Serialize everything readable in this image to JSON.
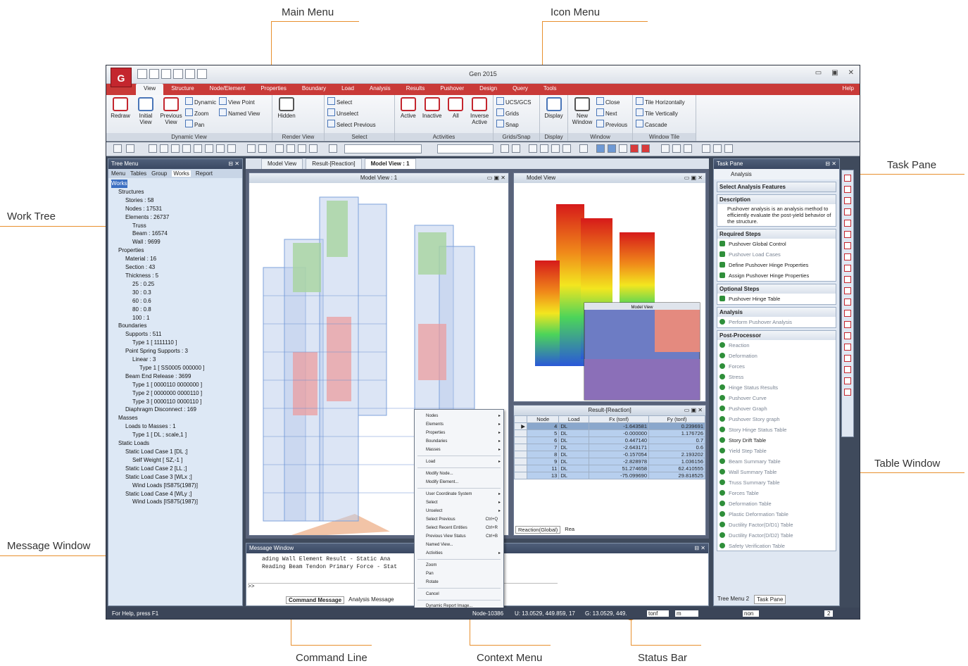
{
  "callouts": {
    "main_menu": "Main Menu",
    "icon_menu": "Icon Menu",
    "task_pane": "Task Pane",
    "work_tree": "Work Tree",
    "table_window": "Table Window",
    "message_window": "Message Window",
    "command_line": "Command Line",
    "context_menu": "Context Menu",
    "status_bar": "Status Bar"
  },
  "app": {
    "logo": "G",
    "title": "Gen 2015",
    "help": "Help",
    "menu_tabs": [
      "View",
      "Structure",
      "Node/Element",
      "Properties",
      "Boundary",
      "Load",
      "Analysis",
      "Results",
      "Pushover",
      "Design",
      "Query",
      "Tools"
    ]
  },
  "ribbon": {
    "dynamic_view": {
      "label": "Dynamic View",
      "redraw": "Redraw",
      "initial": "Initial View",
      "previous": "Previous View",
      "dynamic": "Dynamic",
      "zoom": "Zoom",
      "pan": "Pan",
      "view_point": "View Point",
      "named_view": "Named View"
    },
    "render_view": {
      "label": "Render View",
      "hidden": "Hidden"
    },
    "select": {
      "label": "Select",
      "select": "Select",
      "unselect": "Unselect",
      "select_previous": "Select Previous"
    },
    "activities": {
      "label": "Activities",
      "active": "Active",
      "inactive": "Inactive",
      "all": "All",
      "inverse": "Inverse Active"
    },
    "grids_snap": {
      "label": "Grids/Snap",
      "ucs": "UCS/GCS",
      "grids": "Grids",
      "snap": "Snap"
    },
    "display": {
      "label": "Display",
      "display": "Display"
    },
    "window": {
      "label": "Window",
      "new_window": "New Window",
      "close": "Close",
      "next": "Next",
      "previous": "Previous"
    },
    "window_tile": {
      "label": "Window Tile",
      "horizontal": "Tile Horizontally",
      "vertical": "Tile Vertically",
      "cascade": "Cascade"
    }
  },
  "tree": {
    "title": "Tree Menu",
    "tabs": [
      "Menu",
      "Tables",
      "Group",
      "Works",
      "Report"
    ],
    "items": [
      "Works",
      "Structures",
      "Stories : 58",
      "Nodes : 17531",
      "Elements : 26737",
      "Truss",
      "Beam : 16574",
      "Wall : 9699",
      "Properties",
      "Material : 16",
      "Section : 43",
      "Thickness : 5",
      "25 : 0.25",
      "30 : 0.3",
      "60 : 0.6",
      "80 : 0.8",
      "100 : 1",
      "Boundaries",
      "Supports : 511",
      "Type 1 [ 1111110 ]",
      "Point Spring Supports : 3",
      "Linear : 3",
      "Type 1 [ SS0005 000000 ]",
      "Beam End Release : 3699",
      "Type 1 [ 0000110 0000000 ]",
      "Type 2 [ 0000000 0000110 ]",
      "Type 3 [ 0000110 0000110 ]",
      "Diaphragm Disconnect : 169",
      "Masses",
      "Loads to Masses : 1",
      "Type 1 [ DL ; scale,1 ]",
      "Static Loads",
      "Static Load Case 1 [DL ;]",
      "Self Weight [ SZ,-1 ]",
      "Static Load Case 2 [LL ;]",
      "Static Load Case 3 [WLx ;]",
      "Wind Loads [IS875(1987)]",
      "Static Load Case 4 [WLy ;]",
      "Wind Loads [IS875(1987)]"
    ]
  },
  "doc_tabs": [
    "Model View",
    "Result-[Reaction]",
    "Model View : 1"
  ],
  "model_view_1": {
    "title": "Model View : 1"
  },
  "model_view_2": {
    "title": "Model View",
    "inset": "Model View"
  },
  "result_table": {
    "title": "Result-[Reaction]",
    "headers": [
      "Node",
      "Load",
      "Fx (tonf)",
      "Fy (tonf)"
    ],
    "rows": [
      [
        "4",
        "DL",
        "-1.643581",
        "0.239691"
      ],
      [
        "5",
        "DL",
        "-0.000000",
        "1.176726"
      ],
      [
        "6",
        "DL",
        "0.447140",
        "0.7",
        "-"
      ],
      [
        "7",
        "DL",
        "-2.643171",
        "0.6",
        "-"
      ],
      [
        "8",
        "DL",
        "-0.157054",
        "2.193202"
      ],
      [
        "9",
        "DL",
        "-2.828978",
        "1.036156"
      ],
      [
        "11",
        "DL",
        "51.274658",
        "62.410555"
      ],
      [
        "13",
        "DL",
        "-75.099690",
        "29.818525"
      ]
    ],
    "sheet_tab": "Reaction(Global)",
    "sheet_tab2": "Rea"
  },
  "task_pane": {
    "title": "Task Pane",
    "mode": "Analysis",
    "features": "Select Analysis Features",
    "description_title": "Description",
    "description": "Pushover analysis is an analysis method to efficiently evaluate the post-yield behavior of the structure.",
    "required_title": "Required Steps",
    "required": [
      "Pushover Global Control",
      "Pushover Load Cases",
      "Define Pushover Hinge Properties",
      "Assign Pushover Hinge Properties"
    ],
    "optional_title": "Optional Steps",
    "optional": [
      "Pushover Hinge Table"
    ],
    "analysis_title": "Analysis",
    "analysis": [
      "Perform Pushover Analysis"
    ],
    "post_title": "Post-Processor",
    "post": [
      "Reaction",
      "Deformation",
      "Forces",
      "Stress",
      "Hinge Status Results",
      "Pushover Curve",
      "Pushover Graph",
      "Pushover Story graph",
      "Story Hinge Status Table",
      "Story Drift Table",
      "Yield Step Table",
      "Beam Summary Table",
      "Wall Summary Table",
      "Truss Summary Table",
      "Forces Table",
      "Deformation Table",
      "Plastic Deformation Table",
      "Ductility Factor(D/D1) Table",
      "Ductility Factor(D/D2) Table",
      "Safety Verification Table"
    ],
    "bottom_tabs": [
      "Tree Menu 2",
      "Task Pane"
    ]
  },
  "message": {
    "title": "Message Window",
    "lines": [
      "ading Wall Element Result - Static Ana",
      "Reading Beam Tendon Primary Force - Stat"
    ],
    "prompt": ">>",
    "tabs": [
      "Command Message",
      "Analysis Message"
    ]
  },
  "context_menu": [
    "Nodes",
    "Elements",
    "Properties",
    "Boundaries",
    "Masses",
    "Load",
    "Modify Node...",
    "Modify Element...",
    "User Coordinate System",
    "Select",
    "Unselect",
    "Select Previous",
    "Select Recent Entities",
    "Previous View Status",
    "Named View...",
    "Activities",
    "Zoom",
    "Pan",
    "Rotate",
    "Cancel",
    "Dynamic Report Image..."
  ],
  "context_shortcuts": {
    "select_previous": "Ctrl+Q",
    "select_recent": "Ctrl+R",
    "previous_view": "Ctrl+B"
  },
  "status": {
    "help": "For Help, press F1",
    "node": "Node-10386",
    "u": "U: 13.0529, 449.859, 17",
    "g": "G: 13.0529, 449.",
    "unit1": "tonf",
    "unit2": "m",
    "mode": "non",
    "page": "2"
  }
}
